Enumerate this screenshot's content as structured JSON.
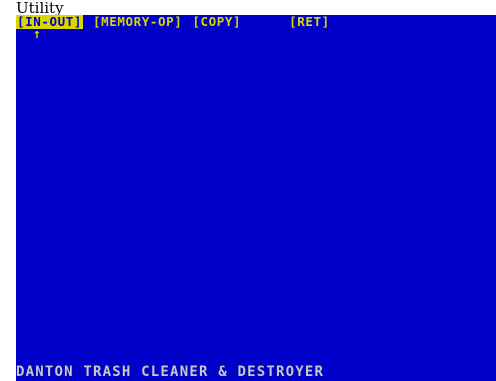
{
  "window": {
    "caption": "Utility"
  },
  "menu": {
    "items": [
      {
        "label": "[IN-OUT]",
        "selected": true
      },
      {
        "label": "[MEMORY-OP]",
        "selected": false
      },
      {
        "label": "[COPY]",
        "selected": false
      },
      {
        "label": "[RET]",
        "selected": false
      }
    ]
  },
  "cursor": {
    "icon": "up-arrow-icon",
    "glyph": "↑"
  },
  "footer": {
    "title": "DANTON TRASH CLEANER & DESTROYER"
  },
  "colors": {
    "screen_background": "#0000c8",
    "menu_text": "#d8d800",
    "footer_text": "#c8c8c8"
  }
}
